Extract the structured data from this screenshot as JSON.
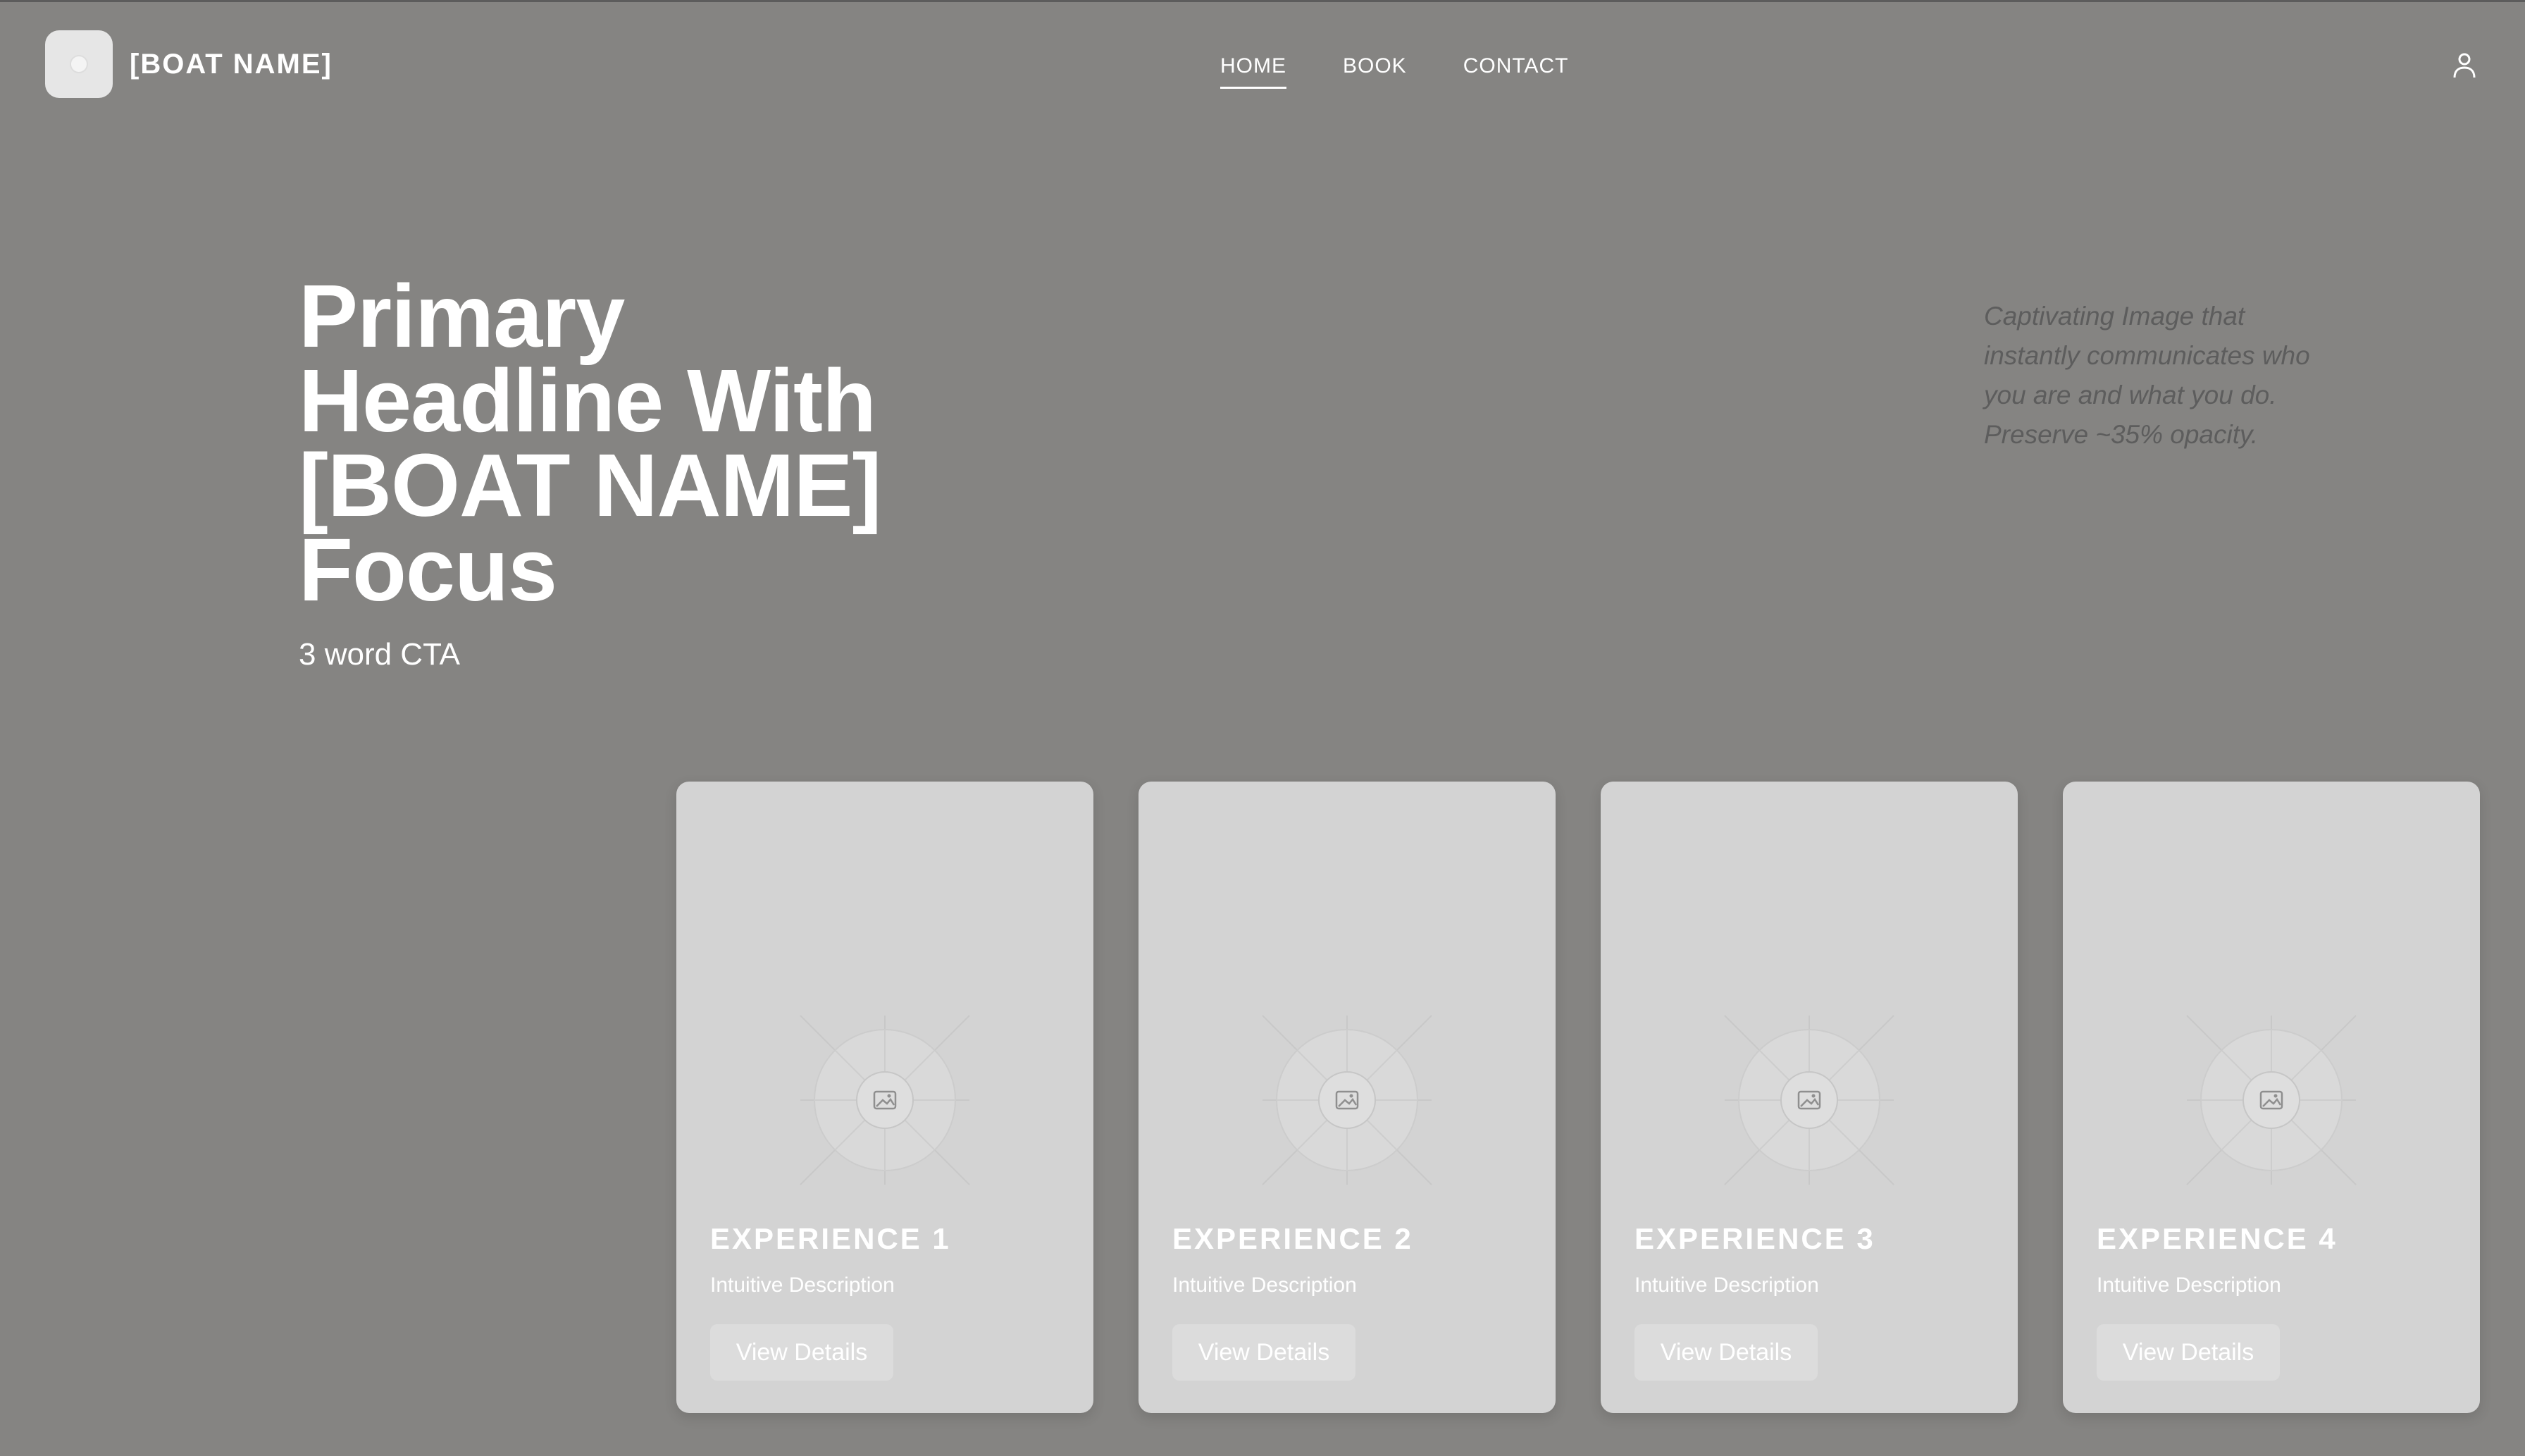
{
  "brand": {
    "name": "[BOAT NAME]",
    "logo_icon": "logo-icon"
  },
  "nav": {
    "items": [
      {
        "label": "HOME",
        "active": true
      },
      {
        "label": "BOOK",
        "active": false
      },
      {
        "label": "CONTACT",
        "active": false
      }
    ]
  },
  "account": {
    "icon": "user-icon"
  },
  "hero": {
    "headline_lines": [
      "Primary",
      "Headline With",
      "[BOAT NAME]",
      "Focus"
    ],
    "cta": "3 word CTA",
    "image_note_lines": [
      "Captivating Image that",
      "instantly communicates who",
      "you are and what you do.",
      "Preserve ~35% opacity."
    ]
  },
  "cards": [
    {
      "title": "EXPERIENCE 1",
      "description": "Intuitive Description",
      "button": "View Details",
      "image_icon": "image-placeholder-icon"
    },
    {
      "title": "EXPERIENCE 2",
      "description": "Intuitive Description",
      "button": "View Details",
      "image_icon": "image-placeholder-icon"
    },
    {
      "title": "EXPERIENCE 3",
      "description": "Intuitive Description",
      "button": "View Details",
      "image_icon": "image-placeholder-icon"
    },
    {
      "title": "EXPERIENCE 4",
      "description": "Intuitive Description",
      "button": "View Details",
      "image_icon": "image-placeholder-icon"
    }
  ],
  "colors": {
    "background": "#858482",
    "card": "#d3d3d3",
    "button": "#dcdcdc",
    "note_text": "#5d5d5d"
  }
}
